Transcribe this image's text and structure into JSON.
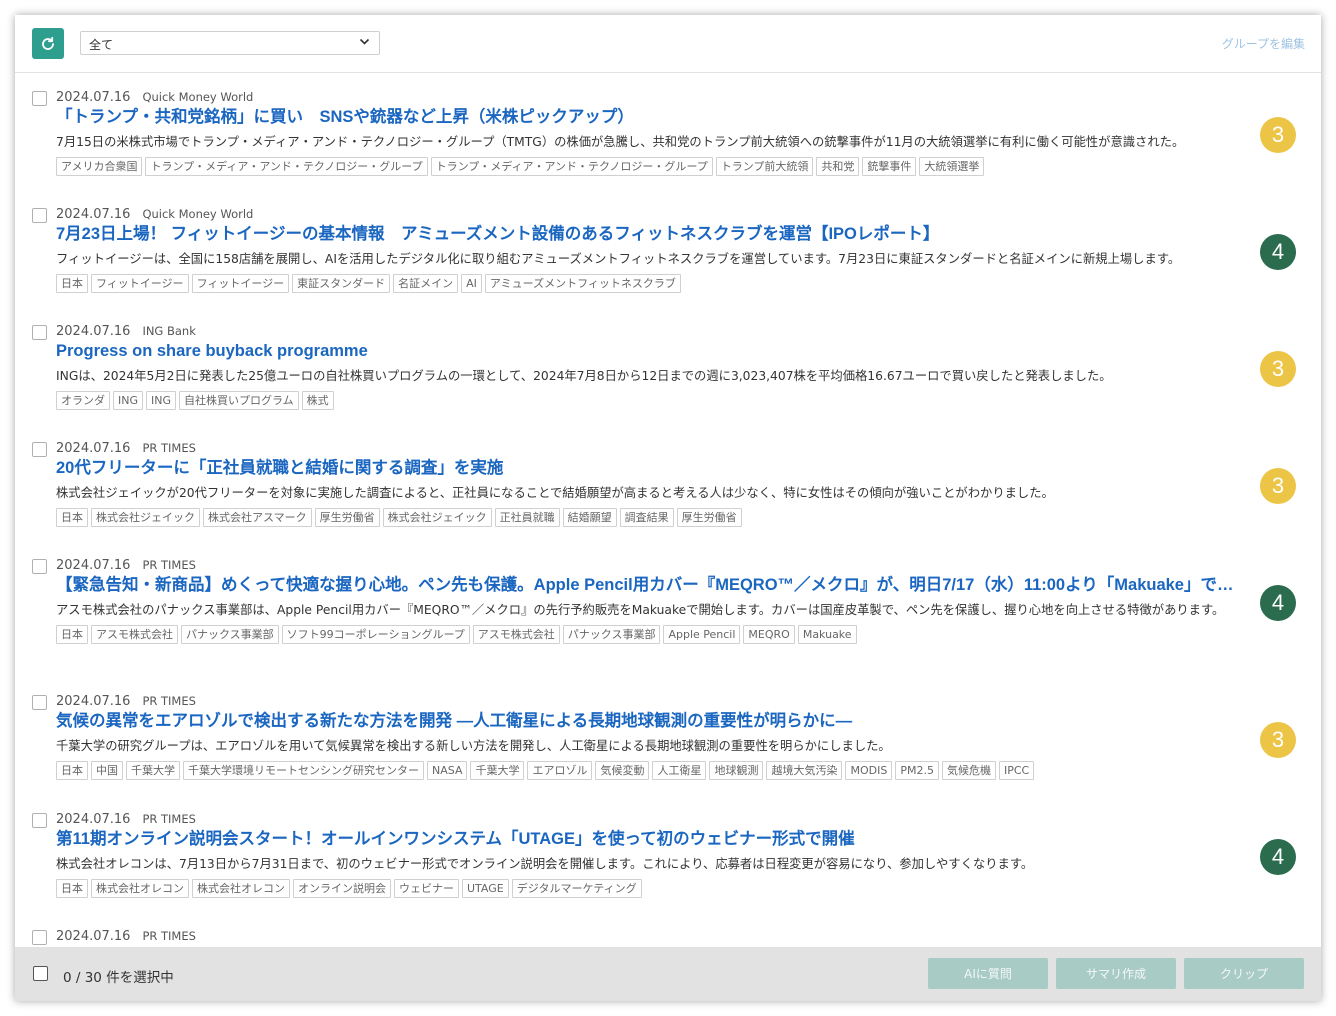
{
  "toolbar": {
    "group_select_value": "全て",
    "edit_group_label": "グループを編集"
  },
  "colors": {
    "accent": "#2e9e8e",
    "title_link": "#1a66c0",
    "score_3": "#ecc546",
    "score_4": "#2b6b4e"
  },
  "articles": [
    {
      "date": "2024.07.16",
      "source": "Quick Money World",
      "title": "「トランプ・共和党銘柄」に買い　SNSや銃器など上昇（米株ピックアップ）",
      "summary": "7月15日の米株式市場でトランプ・メディア・アンド・テクノロジー・グループ（TMTG）の株価が急騰し、共和党のトランプ前大統領への銃撃事件が11月の大統領選挙に有利に働く可能性が意識された。",
      "tags": [
        "アメリカ合衆国",
        "トランプ・メディア・アンド・テクノロジー・グループ",
        "トランプ・メディア・アンド・テクノロジー・グループ",
        "トランプ前大統領",
        "共和党",
        "銃撃事件",
        "大統領選挙"
      ],
      "score": "3"
    },
    {
      "date": "2024.07.16",
      "source": "Quick Money World",
      "title": "7月23日上場！ フィットイージーの基本情報　アミューズメント設備のあるフィットネスクラブを運営【IPOレポート】",
      "summary": "フィットイージーは、全国に158店舗を展開し、AIを活用したデジタル化に取り組むアミューズメントフィットネスクラブを運営しています。7月23日に東証スタンダードと名証メインに新規上場します。",
      "tags": [
        "日本",
        "フィットイージー",
        "フィットイージー",
        "東証スタンダード",
        "名証メイン",
        "AI",
        "アミューズメントフィットネスクラブ"
      ],
      "score": "4"
    },
    {
      "date": "2024.07.16",
      "source": "ING Bank",
      "title": "Progress on share buyback programme",
      "summary": "INGは、2024年5月2日に発表した25億ユーロの自社株買いプログラムの一環として、2024年7月8日から12日までの週に3,023,407株を平均価格16.67ユーロで買い戻したと発表しました。",
      "tags": [
        "オランダ",
        "ING",
        "ING",
        "自社株買いプログラム",
        "株式"
      ],
      "score": "3"
    },
    {
      "date": "2024.07.16",
      "source": "PR TIMES",
      "title": "20代フリーターに「正社員就職と結婚に関する調査」を実施",
      "summary": "株式会社ジェイックが20代フリーターを対象に実施した調査によると、正社員になることで結婚願望が高まると考える人は少なく、特に女性はその傾向が強いことがわかりました。",
      "tags": [
        "日本",
        "株式会社ジェイック",
        "株式会社アスマーク",
        "厚生労働省",
        "株式会社ジェイック",
        "正社員就職",
        "結婚願望",
        "調査結果",
        "厚生労働省"
      ],
      "score": "3"
    },
    {
      "date": "2024.07.16",
      "source": "PR TIMES",
      "title": "【緊急告知・新商品】めくって快適な握り心地。ペン先も保護。Apple Pencil用カバー『MEQRO™／メクロ』が、明日7/17（水）11:00より「Makuake」で先行予約販売開始",
      "summary": "アスモ株式会社のパナックス事業部は、Apple Pencil用カバー『MEQRO™／メクロ』の先行予約販売をMakuakeで開始します。カバーは国産皮革製で、ペン先を保護し、握り心地を向上させる特徴があります。",
      "tags": [
        "日本",
        "アスモ株式会社",
        "パナックス事業部",
        "ソフト99コーポレーショングループ",
        "アスモ株式会社",
        "パナックス事業部",
        "Apple Pencil",
        "MEQRO",
        "Makuake"
      ],
      "score": "4"
    },
    {
      "date": "2024.07.16",
      "source": "PR TIMES",
      "title": "気候の異常をエアロゾルで検出する新たな方法を開発 —人工衛星による長期地球観測の重要性が明らかに—",
      "summary": "千葉大学の研究グループは、エアロゾルを用いて気候異常を検出する新しい方法を開発し、人工衛星による長期地球観測の重要性を明らかにしました。",
      "tags": [
        "日本",
        "中国",
        "千葉大学",
        "千葉大学環境リモートセンシング研究センター",
        "NASA",
        "千葉大学",
        "エアロゾル",
        "気候変動",
        "人工衛星",
        "地球観測",
        "越境大気汚染",
        "MODIS",
        "PM2.5",
        "気候危機",
        "IPCC"
      ],
      "score": "3"
    },
    {
      "date": "2024.07.16",
      "source": "PR TIMES",
      "title": "第11期オンライン説明会スタート！オールインワンシステム「UTAGE」を使って初のウェビナー形式で開催",
      "summary": "株式会社オレコンは、7月13日から7月31日まで、初のウェビナー形式でオンライン説明会を開催します。これにより、応募者は日程変更が容易になり、参加しやすくなります。",
      "tags": [
        "日本",
        "株式会社オレコン",
        "株式会社オレコン",
        "オンライン説明会",
        "ウェビナー",
        "UTAGE",
        "デジタルマーケティング"
      ],
      "score": "4"
    },
    {
      "date": "2024.07.16",
      "source": "PR TIMES",
      "title": "",
      "summary": "",
      "tags": [],
      "score": ""
    }
  ],
  "footer": {
    "selected_count_text": "0 / 30 件を選択中",
    "ask_ai_label": "AIに質問",
    "summary_label": "サマリ作成",
    "clip_label": "クリップ"
  }
}
